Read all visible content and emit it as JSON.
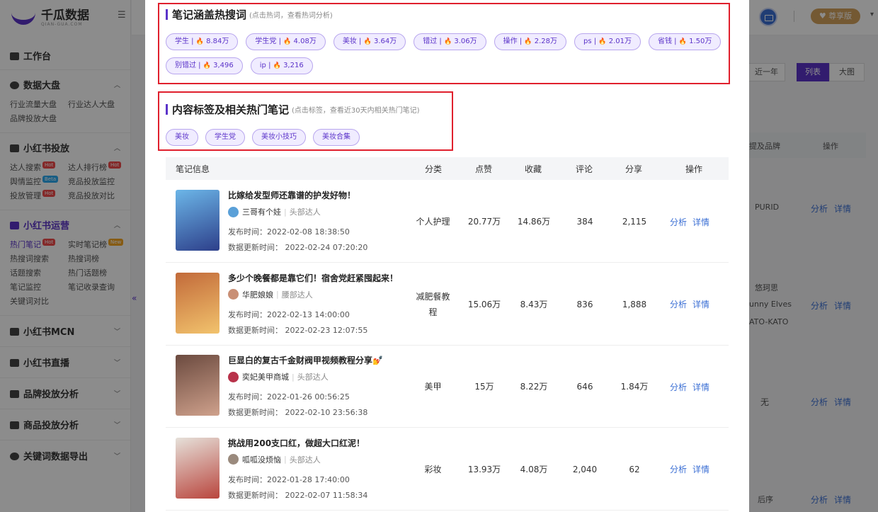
{
  "brand": {
    "name": "千瓜数据",
    "sub": "QIAN-GUA.COM"
  },
  "sidebar": {
    "workbench": "工作台",
    "sections": [
      {
        "title": "数据大盘",
        "items": [
          "行业流量大盘",
          "行业达人大盘",
          "品牌投放大盘"
        ]
      },
      {
        "title": "小红书投放",
        "items": [
          "达人搜索",
          "达人排行榜",
          "舆情监控",
          "竞品投放监控",
          "投放管理",
          "竞品投放对比"
        ]
      },
      {
        "title": "小红书运营",
        "items": [
          "热门笔记",
          "实时笔记榜",
          "热搜词搜索",
          "热搜词榜",
          "话题搜索",
          "热门话题榜",
          "笔记监控",
          "笔记收录查询",
          "关键词对比"
        ]
      }
    ],
    "collapsed": [
      "小红书MCN",
      "小红书直播",
      "品牌投放分析",
      "商品投放分析",
      "关键词数据导出"
    ],
    "badges": {
      "hot": "Hot",
      "beta": "Beta",
      "new": "New"
    }
  },
  "header": {
    "vip_label": "尊享版"
  },
  "background": {
    "range_btn": "近一年",
    "view_list": "列表",
    "view_big": "大图",
    "col_brand": "提及品牌",
    "col_ops": "操作",
    "rows": [
      {
        "brand": "PURID"
      },
      {
        "brand": "悠珂思",
        "brand2": "unny Elves",
        "brand3": "ATO-KATO"
      },
      {
        "brand": "无"
      },
      {
        "brand": "后序"
      }
    ],
    "link_analyze": "分析",
    "link_detail": "详情"
  },
  "modal": {
    "hot_words": {
      "title": "笔记涵盖热搜词",
      "note": "(点击热词，查看热词分析)",
      "chips": [
        {
          "word": "学生",
          "count": "8.84万"
        },
        {
          "word": "学生党",
          "count": "4.08万"
        },
        {
          "word": "美妆",
          "count": "3.64万"
        },
        {
          "word": "错过",
          "count": "3.06万"
        },
        {
          "word": "操作",
          "count": "2.28万"
        },
        {
          "word": "ps",
          "count": "2.01万"
        },
        {
          "word": "省钱",
          "count": "1.50万"
        },
        {
          "word": "别错过",
          "count": "3,496"
        },
        {
          "word": "ip",
          "count": "3,216"
        }
      ]
    },
    "tags": {
      "title": "内容标签及相关热门笔记",
      "note": "(点击标签，查看近30天内相关热门笔记)",
      "chips": [
        "美妆",
        "学生党",
        "美妆小技巧",
        "美妆合集"
      ]
    },
    "table": {
      "headers": {
        "info": "笔记信息",
        "category": "分类",
        "likes": "点赞",
        "favs": "收藏",
        "comments": "评论",
        "shares": "分享",
        "ops": "操作"
      },
      "analyze": "分析",
      "detail": "详情",
      "rows": [
        {
          "title": "比嫁给发型师还靠谱的护发好物！",
          "author": "三哥有个娃",
          "level": "头部达人",
          "published": "发布时间：2022-02-08 18:38:50",
          "updated": "数据更新时间：  2022-02-24 07:20:20",
          "category": "个人护理",
          "likes": "20.77万",
          "favs": "14.86万",
          "comments": "384",
          "shares": "2,115",
          "thumb_colors": [
            "#6cb6e8",
            "#2d3f8a"
          ],
          "avatar_color": "#5aa0d8"
        },
        {
          "title": "多少个晚餐都是靠它们！宿舍党赶紧囤起来！",
          "author": "华肥娘娘",
          "level": "腰部达人",
          "published": "发布时间：2022-02-13 14:00:00",
          "updated": "数据更新时间：  2022-02-23 12:07:55",
          "category": "减肥餐教程",
          "likes": "15.06万",
          "favs": "8.43万",
          "comments": "836",
          "shares": "1,888",
          "thumb_colors": [
            "#c26a3a",
            "#f2c36d"
          ],
          "avatar_color": "#c98f75"
        },
        {
          "title": "巨显白的复古千金财阀甲视频教程分享💅",
          "author": "奕妃美甲商城",
          "level": "头部达人",
          "published": "发布时间：2022-01-26 00:56:25",
          "updated": "数据更新时间：  2022-02-10 23:56:38",
          "category": "美甲",
          "likes": "15万",
          "favs": "8.22万",
          "comments": "646",
          "shares": "1.84万",
          "thumb_colors": [
            "#6b4a3f",
            "#cfa18c"
          ],
          "avatar_color": "#b8324a"
        },
        {
          "title": "挑战用200支口红，做超大口红泥！",
          "author": "呱呱没烦恼",
          "level": "头部达人",
          "published": "发布时间：2022-01-28 17:40:00",
          "updated": "数据更新时间：  2022-02-07 11:58:34",
          "category": "彩妆",
          "likes": "13.93万",
          "favs": "4.08万",
          "comments": "2,040",
          "shares": "62",
          "thumb_colors": [
            "#e6e1da",
            "#b9453d"
          ],
          "avatar_color": "#9a8a7d"
        }
      ]
    }
  }
}
